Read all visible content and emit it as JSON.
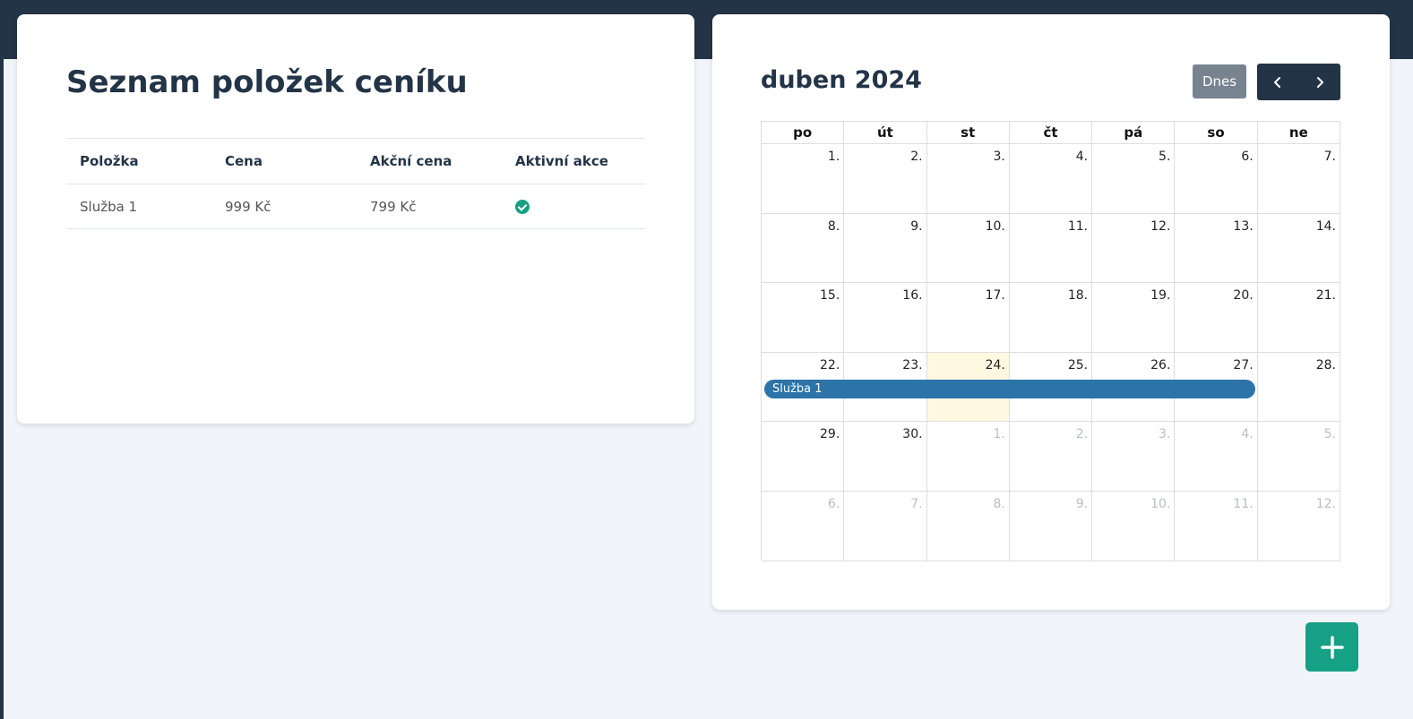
{
  "price_list": {
    "title": "Seznam položek ceníku",
    "columns": [
      "Položka",
      "Cena",
      "Akční cena",
      "Aktivní akce"
    ],
    "rows": [
      {
        "item": "Služba 1",
        "price": "999 Kč",
        "sale_price": "799 Kč",
        "active_sale": "check-circle-icon"
      }
    ]
  },
  "calendar": {
    "title": "duben 2024",
    "today_label": "Dnes",
    "prev_icon": "chevron-left-icon",
    "next_icon": "chevron-right-icon",
    "weekdays": [
      "po",
      "út",
      "st",
      "čt",
      "pá",
      "so",
      "ne"
    ],
    "weeks": [
      [
        "1.",
        "2.",
        "3.",
        "4.",
        "5.",
        "6.",
        "7."
      ],
      [
        "8.",
        "9.",
        "10.",
        "11.",
        "12.",
        "13.",
        "14."
      ],
      [
        "15.",
        "16.",
        "17.",
        "18.",
        "19.",
        "20.",
        "21."
      ],
      [
        "22.",
        "23.",
        "24.",
        "25.",
        "26.",
        "27.",
        "28."
      ],
      [
        "29.",
        "30.",
        "1.",
        "2.",
        "3.",
        "4.",
        "5."
      ],
      [
        "6.",
        "7.",
        "8.",
        "9.",
        "10.",
        "11.",
        "12."
      ]
    ],
    "today": "24.",
    "event": {
      "label": "Služba 1",
      "color": "#2c73a8"
    }
  },
  "fab": {
    "icon": "plus-icon",
    "color": "#16a085"
  },
  "colors": {
    "header": "#243447",
    "accent": "#16a085",
    "background": "#f1f5f9"
  }
}
